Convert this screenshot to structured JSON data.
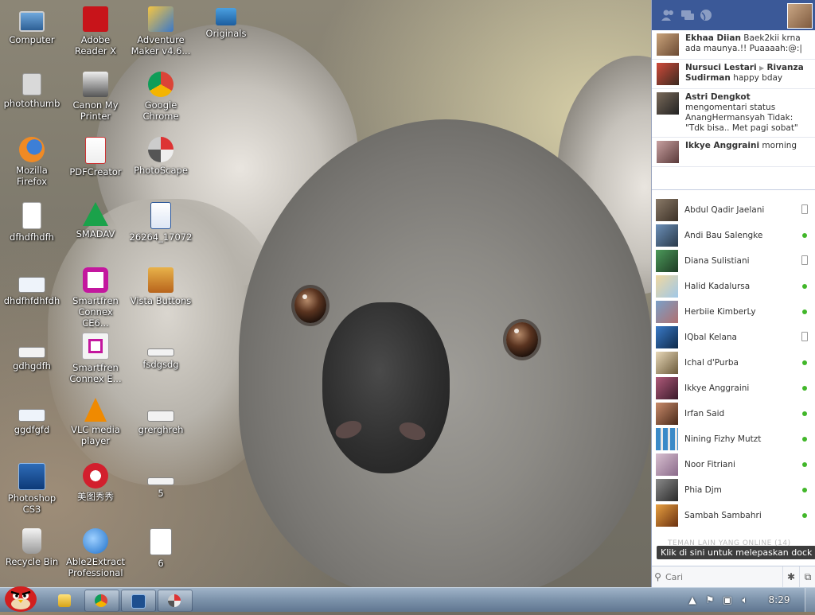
{
  "desktop": {
    "icons": [
      {
        "label": "Computer"
      },
      {
        "label": "Adobe Reader X"
      },
      {
        "label": "Adventure Maker v4.6..."
      },
      {
        "label": "Originals"
      },
      {
        "label": "photothumb"
      },
      {
        "label": "Canon My Printer"
      },
      {
        "label": "Google Chrome"
      },
      {
        "label": "Mozilla Firefox"
      },
      {
        "label": "PDFCreator"
      },
      {
        "label": "PhotoScape"
      },
      {
        "label": "dfhdfhdfh"
      },
      {
        "label": "SMADAV"
      },
      {
        "label": "26264_17072"
      },
      {
        "label": "dhdfhfdhfdh"
      },
      {
        "label": "Smartfren Connex CE6..."
      },
      {
        "label": "Vista Buttons"
      },
      {
        "label": "gdhgdfh"
      },
      {
        "label": "Smartfren Connex E..."
      },
      {
        "label": "fsdgsdg"
      },
      {
        "label": "ggdfgfd"
      },
      {
        "label": "VLC media player"
      },
      {
        "label": "grerghreh"
      },
      {
        "label": "Photoshop CS3"
      },
      {
        "label": "美图秀秀"
      },
      {
        "label": "5"
      },
      {
        "label": "Recycle Bin"
      },
      {
        "label": "Able2Extract Professional"
      },
      {
        "label": "6"
      }
    ]
  },
  "chat": {
    "ticker": [
      {
        "name": "Ekhaa Diian",
        "text": "Baek2kii krna ada maunya.!! Puaaaah:@:|"
      },
      {
        "name": "Nursuci Lestari",
        "target": "Rivanza Sudirman",
        "text": "happy bday"
      },
      {
        "name": "Astri Dengkot",
        "text": "mengomentari status AnangHermansyah Tidak: \"Tdk bisa.. Met pagi sobat\""
      },
      {
        "name": "Ikkye Anggraini",
        "text": "morning"
      }
    ],
    "friends": [
      {
        "name": "Abdul Qadir Jaelani",
        "status": "mobile"
      },
      {
        "name": "Andi Bau Salengke",
        "status": "online"
      },
      {
        "name": "Diana Sulistiani",
        "status": "mobile"
      },
      {
        "name": "Halid Kadalursa",
        "status": "online"
      },
      {
        "name": "Herbiie KimberLy",
        "status": "online"
      },
      {
        "name": "IQbal Kelana",
        "status": "mobile"
      },
      {
        "name": "Ichal d'Purba",
        "status": "online"
      },
      {
        "name": "Ikkye Anggraini",
        "status": "online"
      },
      {
        "name": "Irfan Said",
        "status": "online"
      },
      {
        "name": "Nining Fizhy Mutzt",
        "status": "online"
      },
      {
        "name": "Noor Fitriani",
        "status": "online"
      },
      {
        "name": "Phia Djm",
        "status": "online"
      },
      {
        "name": "Sambah Sambahri",
        "status": "online"
      }
    ],
    "more_label": "TEMAN LAIN YANG ONLINE (14)",
    "tooltip": "Klik di sini untuk melepaskan dock",
    "search_placeholder": "Cari",
    "colors": {
      "header": "#3b5998",
      "online": "#42b72a"
    }
  },
  "taskbar": {
    "clock": "8:29",
    "apps": [
      "explorer-icon",
      "chrome-icon",
      "photoshop-icon",
      "photoscape-icon"
    ]
  }
}
